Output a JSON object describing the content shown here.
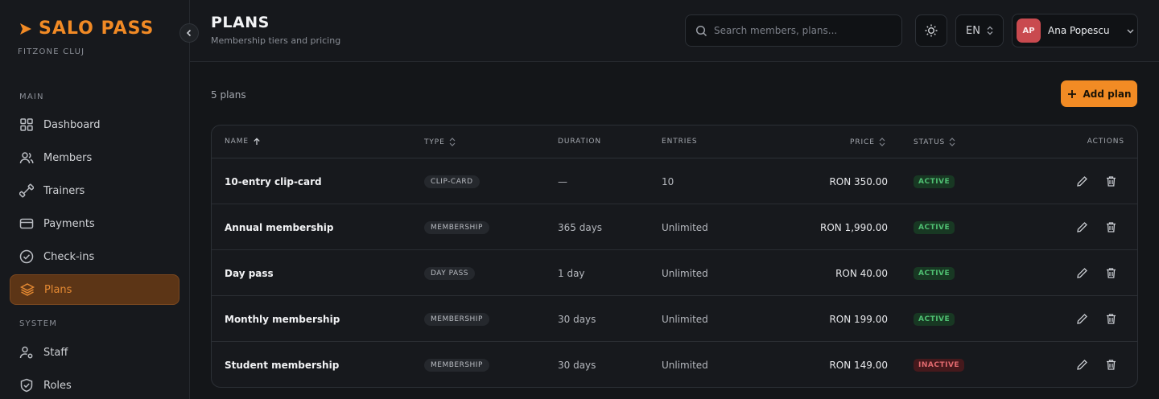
{
  "brand": {
    "name": "SALO PASS",
    "gym": "FITZONE CLUJ",
    "accent": "#f18a25"
  },
  "sidebar": {
    "sections": [
      {
        "label": "MAIN"
      },
      {
        "label": "SYSTEM"
      }
    ],
    "items": [
      {
        "label": "Dashboard",
        "icon": "grid-icon"
      },
      {
        "label": "Members",
        "icon": "users-icon"
      },
      {
        "label": "Trainers",
        "icon": "dumbbell-icon"
      },
      {
        "label": "Payments",
        "icon": "credit-card-icon"
      },
      {
        "label": "Check-ins",
        "icon": "check-circle-icon"
      },
      {
        "label": "Plans",
        "icon": "layers-icon",
        "active": true
      },
      {
        "label": "Staff",
        "icon": "user-cog-icon"
      },
      {
        "label": "Roles",
        "icon": "shield-check-icon"
      }
    ]
  },
  "header": {
    "title": "PLANS",
    "subtitle": "Membership tiers and pricing",
    "search_placeholder": "Search members, plans...",
    "language": "EN",
    "user": {
      "initials": "AP",
      "name": "Ana Popescu"
    }
  },
  "main": {
    "count_label": "5 plans",
    "add_button": "Add plan",
    "columns": {
      "name": "NAME",
      "type": "TYPE",
      "duration": "DURATION",
      "entries": "ENTRIES",
      "price": "PRICE",
      "status": "STATUS",
      "actions": "ACTIONS"
    },
    "rows": [
      {
        "name": "10-entry clip-card",
        "type": "CLIP-CARD",
        "duration": "—",
        "entries": "10",
        "price": "RON 350.00",
        "status": "ACTIVE"
      },
      {
        "name": "Annual membership",
        "type": "MEMBERSHIP",
        "duration": "365 days",
        "entries": "Unlimited",
        "price": "RON 1,990.00",
        "status": "ACTIVE"
      },
      {
        "name": "Day pass",
        "type": "DAY PASS",
        "duration": "1 day",
        "entries": "Unlimited",
        "price": "RON 40.00",
        "status": "ACTIVE"
      },
      {
        "name": "Monthly membership",
        "type": "MEMBERSHIP",
        "duration": "30 days",
        "entries": "Unlimited",
        "price": "RON 199.00",
        "status": "ACTIVE"
      },
      {
        "name": "Student membership",
        "type": "MEMBERSHIP",
        "duration": "30 days",
        "entries": "Unlimited",
        "price": "RON 149.00",
        "status": "INACTIVE"
      }
    ]
  },
  "colors": {
    "active": "#4fbf72",
    "inactive": "#e26a6f",
    "primary": "#f28b24"
  }
}
